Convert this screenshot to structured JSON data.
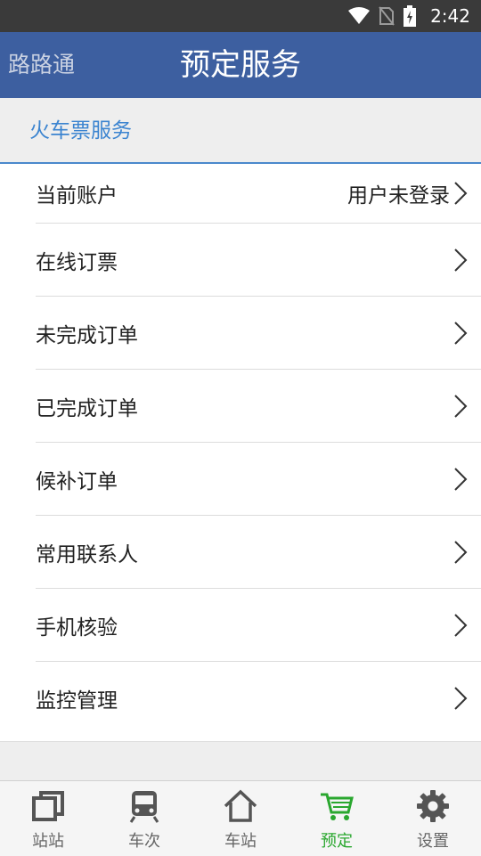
{
  "status_bar": {
    "time": "2:42",
    "icons": [
      "wifi-icon",
      "no-sim-icon",
      "battery-charging-icon"
    ]
  },
  "app_bar": {
    "app_name": "路路通",
    "title": "预定服务"
  },
  "section": {
    "title": "火车票服务"
  },
  "menu": {
    "items": [
      {
        "label": "当前账户",
        "value": "用户未登录"
      },
      {
        "label": "在线订票"
      },
      {
        "label": "未完成订单"
      },
      {
        "label": "已完成订单"
      },
      {
        "label": "候补订单"
      },
      {
        "label": "常用联系人"
      },
      {
        "label": "手机核验"
      },
      {
        "label": "监控管理"
      }
    ]
  },
  "bottom_nav": {
    "items": [
      {
        "label": "站站",
        "icon": "station-to-station-icon"
      },
      {
        "label": "车次",
        "icon": "train-icon"
      },
      {
        "label": "车站",
        "icon": "home-station-icon"
      },
      {
        "label": "预定",
        "icon": "cart-icon",
        "active": true
      },
      {
        "label": "设置",
        "icon": "gear-icon"
      }
    ]
  },
  "colors": {
    "app_bar": "#3d5fa0",
    "section_text": "#3b84d0",
    "active_tab": "#2aa72f"
  }
}
